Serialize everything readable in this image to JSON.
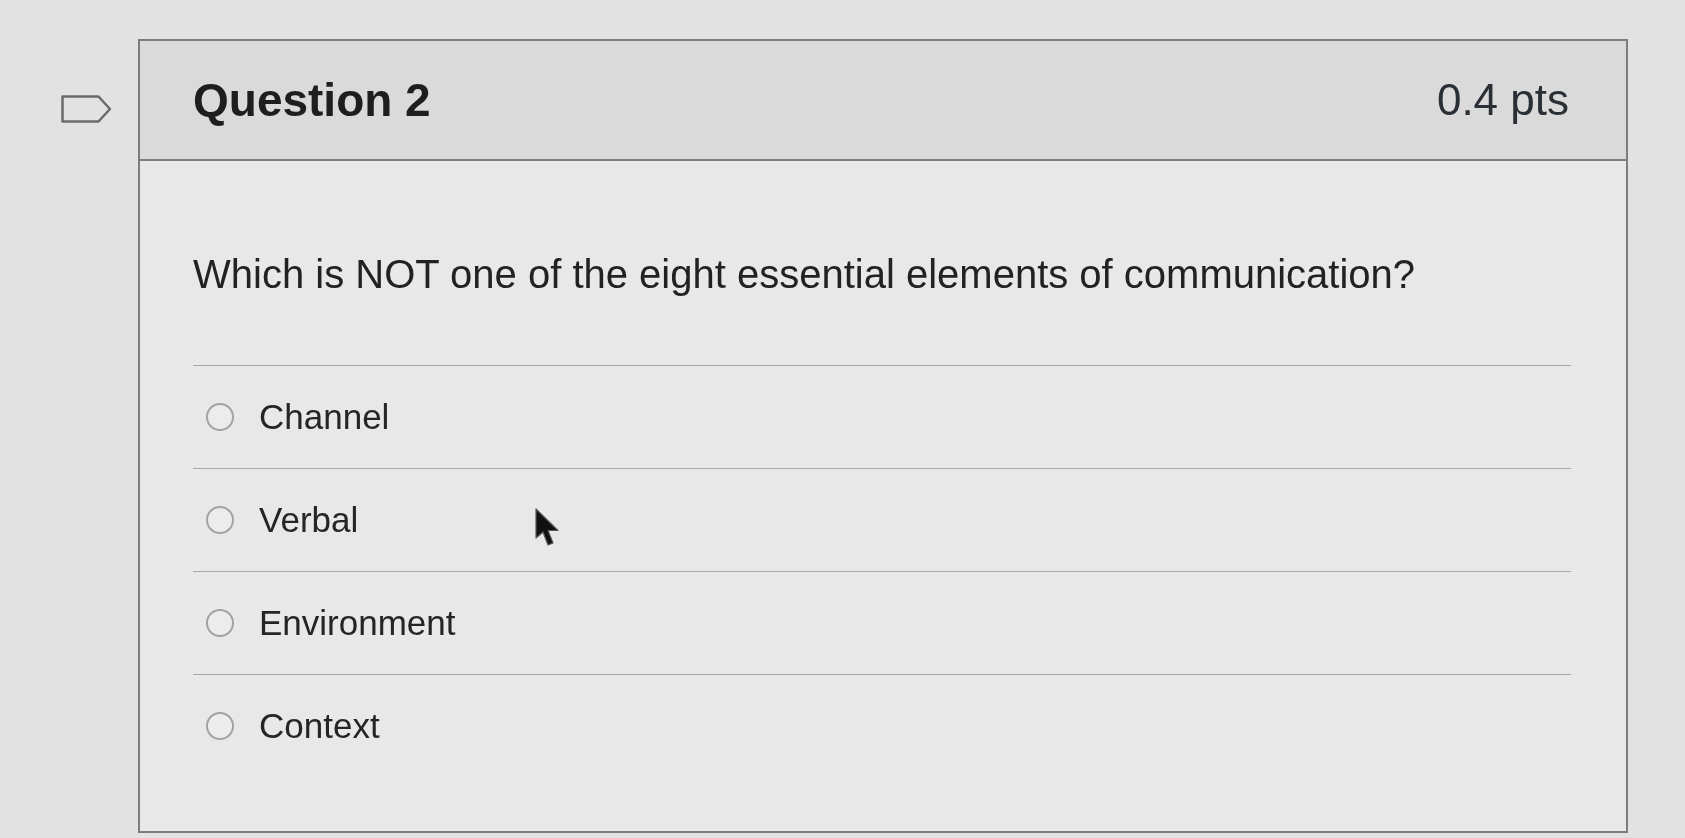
{
  "question": {
    "title": "Question 2",
    "points": "0.4 pts",
    "flagged": false,
    "prompt": "Which is NOT one of the eight essential elements of communication?"
  },
  "answers": [
    {
      "label": "Channel",
      "selected": false
    },
    {
      "label": "Verbal",
      "selected": false
    },
    {
      "label": "Environment",
      "selected": false
    },
    {
      "label": "Context",
      "selected": false
    }
  ]
}
